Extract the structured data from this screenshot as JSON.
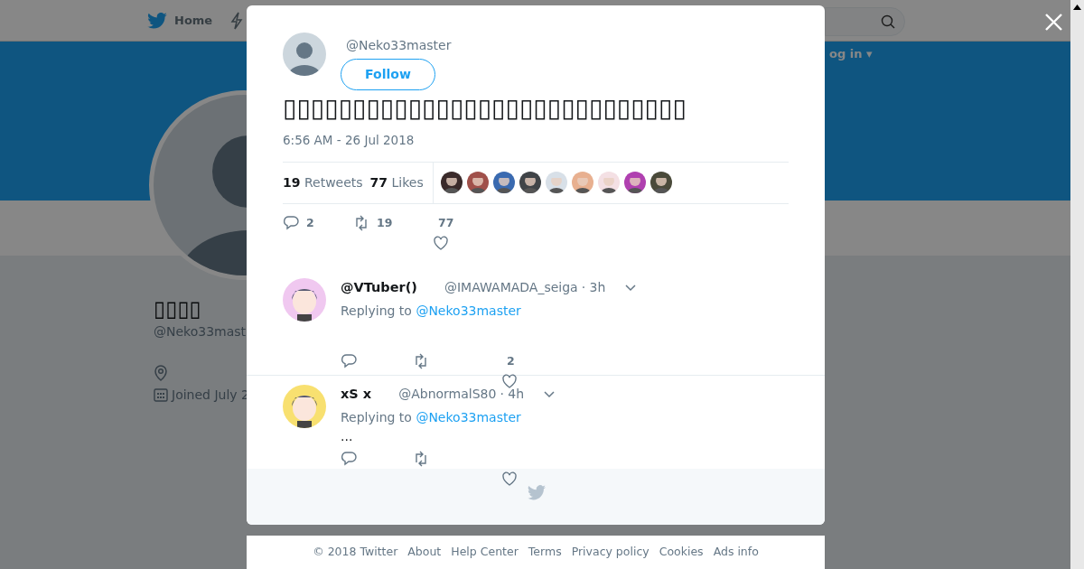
{
  "background_page": {
    "nav": [
      {
        "kind": "home",
        "label": "Home"
      },
      {
        "kind": "moments"
      }
    ],
    "login": "og in ▾",
    "profile": {
      "name": "▯▯▯▯",
      "handle": "@Neko33mast",
      "joined": "Joined July 2"
    }
  },
  "modal": {
    "author": {
      "handle": "@Neko33master"
    },
    "follow_label": "Follow",
    "text": "▯▯▯▯▯▯▯▯▯▯▯▯▯▯▯▯▯▯▯▯▯▯▯▯▯▯▯▯▯",
    "timestamp": "6:56 AM - 26 Jul 2018",
    "stats": [
      {
        "count": "19",
        "label": "Retweets"
      },
      {
        "count": "77",
        "label": "Likes"
      }
    ],
    "actions": [
      {
        "kind": "reply",
        "count": "2"
      },
      {
        "kind": "retweet",
        "count": "19"
      },
      {
        "kind": "like",
        "count": "77"
      }
    ],
    "replies": [
      {
        "name": "@VTuber()",
        "handle": "@IMAWAMADA_seiga",
        "time": "· 3h",
        "replying_label": "Replying to",
        "replying_to": "@Neko33master",
        "actions": [
          {
            "kind": "reply"
          },
          {
            "kind": "retweet"
          },
          {
            "kind": "like",
            "count": "2"
          }
        ]
      },
      {
        "name": "xS x",
        "handle": "@AbnormalS80",
        "time": "· 4h",
        "replying_label": "Replying to",
        "replying_to": "@Neko33master",
        "text": "...",
        "actions": [
          {
            "kind": "reply"
          },
          {
            "kind": "retweet"
          },
          {
            "kind": "like"
          }
        ]
      }
    ]
  },
  "footer": {
    "links": [
      "© 2018 Twitter",
      "About",
      "Help Center",
      "Terms",
      "Privacy policy",
      "Cookies",
      "Ads info"
    ]
  }
}
